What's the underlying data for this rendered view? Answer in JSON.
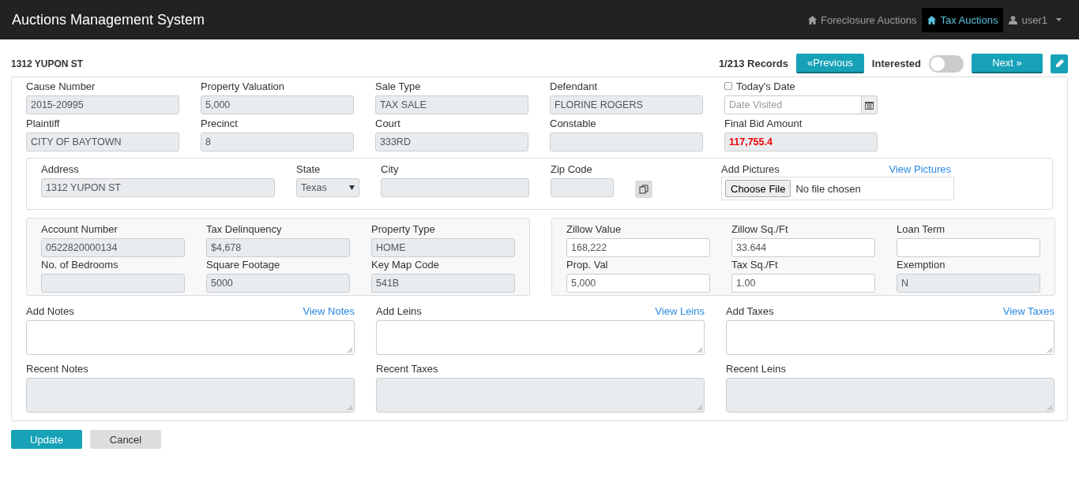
{
  "navbar": {
    "brand": "Auctions Management System",
    "links": [
      {
        "label": "Foreclosure Auctions",
        "selected": false
      },
      {
        "label": "Tax Auctions",
        "selected": true
      }
    ],
    "user": "user1"
  },
  "header": {
    "title": "1312 YUPON ST",
    "records": "1/213 Records",
    "previous": "«Previous",
    "interested_label": "Interested",
    "interested_on": false,
    "next": "Next »"
  },
  "top_fields": [
    {
      "kind": "text",
      "label": "Cause Number",
      "value": "2015-20995",
      "disabled": true,
      "alert": false
    },
    {
      "kind": "text",
      "label": "Property Valuation",
      "value": "5,000",
      "disabled": true,
      "alert": false
    },
    {
      "kind": "text",
      "label": "Sale Type",
      "value": "TAX SALE",
      "disabled": true,
      "alert": false
    },
    {
      "kind": "text",
      "label": "Defendant",
      "value": "FLORINE ROGERS",
      "disabled": true,
      "alert": false
    },
    {
      "kind": "date",
      "label": "Today's Date",
      "checked": false,
      "placeholder": "Date Visited"
    },
    {
      "kind": "text",
      "label": "Plaintiff",
      "value": "CITY OF BAYTOWN",
      "disabled": true,
      "alert": false
    },
    {
      "kind": "text",
      "label": "Precinct",
      "value": "8",
      "disabled": true,
      "alert": false
    },
    {
      "kind": "text",
      "label": "Court",
      "value": "333RD",
      "disabled": true,
      "alert": false
    },
    {
      "kind": "text",
      "label": "Constable",
      "disabled": true,
      "alert": false
    },
    {
      "kind": "text",
      "label": "Final Bid Amount",
      "value": "117,755.4",
      "disabled": true,
      "alert": true
    }
  ],
  "address": {
    "address_label": "Address",
    "address_value": "1312 YUPON ST",
    "state_label": "State",
    "state_value": "Texas",
    "city_label": "City",
    "zip_label": "Zip Code",
    "pictures_label": "Add Pictures",
    "pictures_link": "View Pictures",
    "file_button": "Choose File",
    "file_status": "No file chosen"
  },
  "left_panel": [
    {
      "label": "Account Number",
      "value": "0522820000134",
      "disabled": true
    },
    {
      "label": "Tax Delinquency",
      "value": "$4,678",
      "disabled": true
    },
    {
      "label": "Property Type",
      "value": "HOME",
      "disabled": true
    },
    {
      "label": "No. of Bedrooms",
      "disabled": true
    },
    {
      "label": "Square Footage",
      "value": "5000",
      "disabled": true
    },
    {
      "label": "Key Map Code",
      "value": "541B",
      "disabled": true
    }
  ],
  "right_panel": [
    {
      "label": "Zillow Value",
      "value": "168,222",
      "disabled": false
    },
    {
      "label": "Zillow Sq./Ft",
      "value": "33.644",
      "disabled": false
    },
    {
      "label": "Loan Term",
      "disabled": false
    },
    {
      "label": "Prop. Val",
      "value": "5,000",
      "disabled": false
    },
    {
      "label": "Tax Sq./Ft",
      "value": "1.00",
      "disabled": false
    },
    {
      "label": "Exemption",
      "value": "N",
      "disabled": true
    }
  ],
  "add_sections": [
    {
      "label": "Add Notes",
      "link": "View Notes"
    },
    {
      "label": "Add Leins",
      "link": "View Leins"
    },
    {
      "label": "Add Taxes",
      "link": "View Taxes"
    }
  ],
  "recent_sections": [
    {
      "label": "Recent Notes"
    },
    {
      "label": "Recent Taxes"
    },
    {
      "label": "Recent Leins"
    }
  ],
  "actions": {
    "update": "Update",
    "cancel": "Cancel"
  }
}
